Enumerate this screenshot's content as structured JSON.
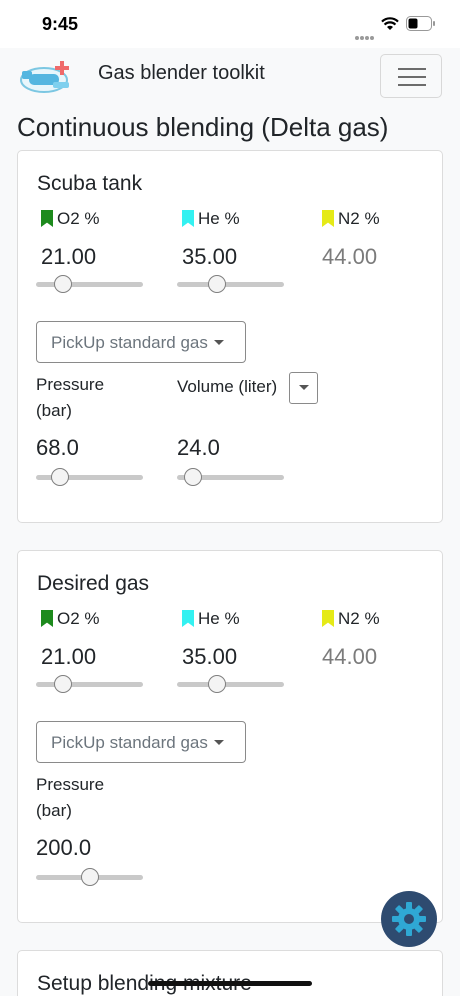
{
  "status": {
    "time": "9:45"
  },
  "app": {
    "title": "Gas blender toolkit"
  },
  "page": {
    "title": "Continuous blending (Delta gas)"
  },
  "colors": {
    "o2_flag": "#1d8a1d",
    "he_flag": "#33f1f1",
    "n2_flag": "#e5ea17",
    "fab": "#2e4b70"
  },
  "scuba": {
    "title": "Scuba tank",
    "o2_label": "O2 %",
    "o2_value": "21.00",
    "o2_slider_fraction": 0.21,
    "he_label": "He %",
    "he_value": "35.00",
    "he_slider_fraction": 0.35,
    "n2_label": "N2 %",
    "n2_value": "44.00",
    "pickup_label": "PickUp standard gas",
    "pressure_label_1": "Pressure",
    "pressure_label_2": "(bar)",
    "pressure_value": "68.0",
    "pressure_slider_fraction": 0.22,
    "volume_label": "Volume (liter)",
    "volume_value": "24.0",
    "volume_slider_fraction": 0.15
  },
  "desired": {
    "title": "Desired gas",
    "o2_label": "O2 %",
    "o2_value": "21.00",
    "o2_slider_fraction": 0.25,
    "he_label": "He %",
    "he_value": "35.00",
    "he_slider_fraction": 0.37,
    "n2_label": "N2 %",
    "n2_value": "44.00",
    "pickup_label": "PickUp standard gas",
    "pressure_label_1": "Pressure",
    "pressure_label_2": "(bar)",
    "pressure_value": "200.0",
    "pressure_slider_fraction": 0.5
  },
  "setup": {
    "title": "Setup blending mixture"
  },
  "icons": {
    "logo": "scuba-tank-logo-icon",
    "menu": "hamburger-menu-icon",
    "fab": "gear-icon"
  }
}
